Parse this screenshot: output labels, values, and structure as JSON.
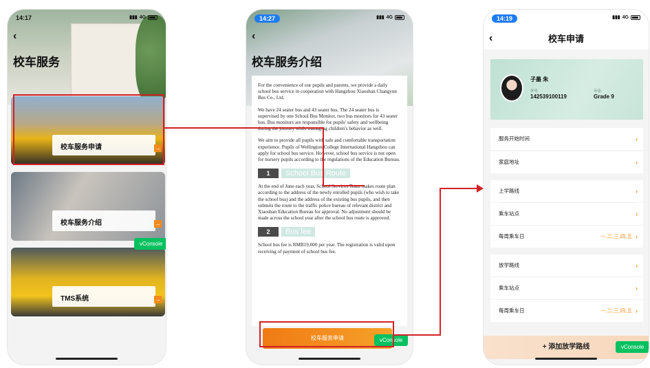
{
  "colors": {
    "accent_red": "#d32026",
    "accent_orange": "#f08b1b",
    "vconsole_green": "#07c160",
    "mint": "#cfe8e2"
  },
  "screen1": {
    "time": "14:17",
    "signal": "4G",
    "title": "校车服务",
    "cards": [
      {
        "label": "校车服务申请"
      },
      {
        "label": "校车服务介绍"
      },
      {
        "label": "TMS系统"
      }
    ],
    "vconsole": "vConsole"
  },
  "screen2": {
    "time": "14:27",
    "signal": "4G",
    "title": "校车服务介绍",
    "paragraphs": [
      "For the convenience of our pupils and parents, we provide a daily school bus service in cooperation with Hangzhou Xiaoshan Changyun Bus Co., Ltd.",
      "We have 24 seater bus and 43 seater bus. The 24 seater bus is supervised by one School Bus Monitor, two bus monitors for 43 seater bus. Bus monitors are responsible for pupils' safety and wellbeing during the journey while managing children's behavior as well.",
      "We aim to provide all pupils with safe and comfortable transportation experience. Pupils of Wellington College International Hangzhou can apply for school bus service. However, school bus service is not open for nursery pupils according to the regulations of the Education Bureau."
    ],
    "section1": {
      "num": "1",
      "name": "School Bus Route"
    },
    "section1_text": "At the end of June each year, School Services Team makes route plan according to the address of the newly enrolled pupils (who wish to take the school bus) and the address of the existing bus pupils, and then submits the route to the traffic police bureau of relevant district and Xiaoshan Education Bureau for approval. No adjustment should be made across the school year after the school bus route is approved.",
    "section2": {
      "num": "2",
      "name": "Bus fee"
    },
    "section2_text": "School bus fee is RMB19,000 per year. The registration is valid upon receiving of payment of school bus fee.",
    "apply_button": "校车服务申请",
    "vconsole": "vConsole"
  },
  "screen3": {
    "time": "14:19",
    "signal": "4G",
    "title": "校车申请",
    "student": {
      "name": "子墨 朱",
      "id_label": "学号",
      "id": "142539100119",
      "grade_label": "年级",
      "grade": "Grade 9"
    },
    "rows": [
      {
        "label": "服务开始时间",
        "value": ""
      },
      {
        "label": "家庭地址",
        "value": ""
      },
      {
        "label": "上学路线",
        "value": ""
      },
      {
        "label": "乘车站点",
        "value": ""
      },
      {
        "label": "每周乘车日",
        "value": "一,二,三,四,五"
      },
      {
        "label": "放学路线",
        "value": ""
      },
      {
        "label": "乘车站点",
        "value": ""
      },
      {
        "label": "每周乘车日",
        "value": "一,二,三,四,五"
      }
    ],
    "add_button": "+ 添加放学路线",
    "vconsole": "vConsole"
  }
}
